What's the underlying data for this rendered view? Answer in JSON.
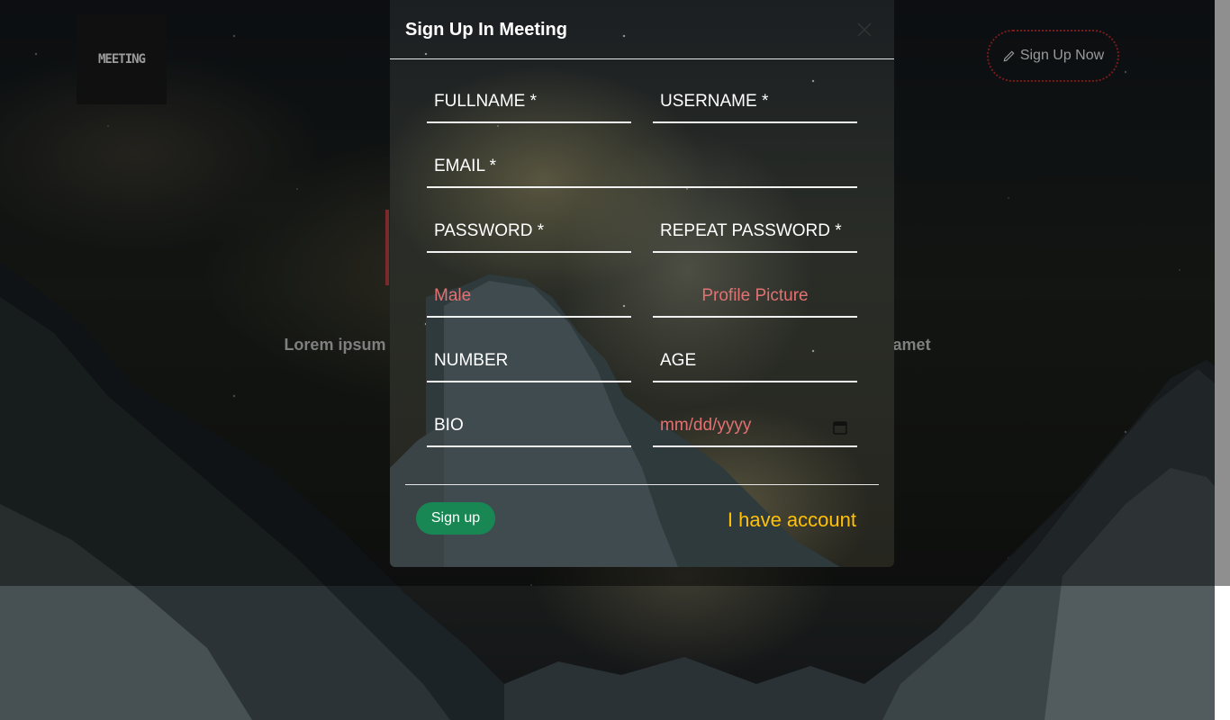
{
  "background": {
    "logo_text": "MEETING",
    "signup_now_label": "Sign Up Now",
    "hero_text": "Lorem ipsum dolor sit amet Lorem ipsum dolor sit amet Lorem ipsum dolor sit amet",
    "accent_color": "#7a1b1b"
  },
  "modal": {
    "title": "Sign Up In Meeting",
    "fields": {
      "fullname": "FULLNAME *",
      "username": "USERNAME *",
      "email": "EMAIL *",
      "password": "PASSWORD *",
      "repeat_password": "REPEAT PASSWORD *",
      "gender": "Male",
      "profile_picture": "Profile Picture",
      "number": "NUMBER",
      "age": "AGE",
      "bio": "BIO",
      "birthdate": "mm/dd/yyyy"
    },
    "signup_button": "Sign up",
    "have_account_link": "I have account",
    "colors": {
      "primary_button": "#198754",
      "link": "#ffc107",
      "placeholder_red": "#e07272"
    }
  }
}
